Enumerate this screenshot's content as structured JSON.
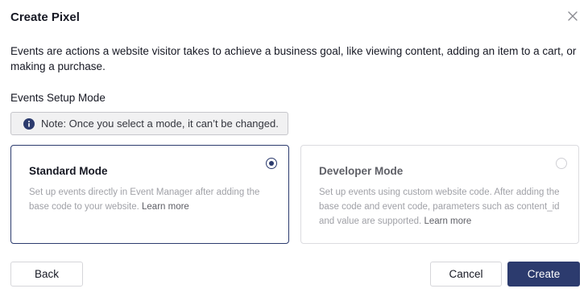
{
  "dialog": {
    "title": "Create Pixel",
    "close_icon": "close-icon"
  },
  "description": "Events are actions a website visitor takes to achieve a business goal, like viewing content, adding an item to a cart, or making a purchase.",
  "setup": {
    "label": "Events Setup Mode",
    "note": "Note: Once you select a mode, it can’t be changed.",
    "note_icon": "info-icon"
  },
  "modes": [
    {
      "title": "Standard Mode",
      "description": "Set up events directly in Event Manager after adding the base code to your website.",
      "link": "Learn more",
      "selected": true
    },
    {
      "title": "Developer Mode",
      "description": "Set up events using custom website code. After adding the base code and event code, parameters such as content_id and value are supported.",
      "link": "Learn more",
      "selected": false
    }
  ],
  "footer": {
    "back_label": "Back",
    "cancel_label": "Cancel",
    "create_label": "Create"
  },
  "colors": {
    "primary": "#2c3b6e",
    "text": "#161823",
    "muted": "#a0a1a7",
    "note_bg": "#f1f1f2"
  }
}
